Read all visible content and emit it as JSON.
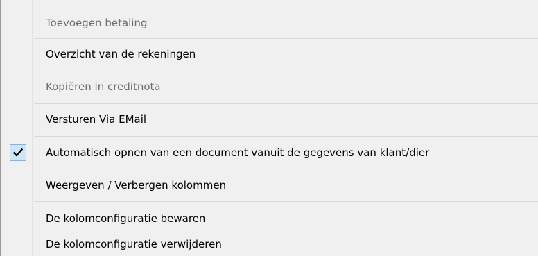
{
  "menu": {
    "items": [
      {
        "label": "Toevoegen betaling",
        "enabled": false,
        "checked": false
      },
      {
        "label": "Overzicht van de rekeningen",
        "enabled": true,
        "checked": false
      },
      {
        "label": "Kopiëren in creditnota",
        "enabled": false,
        "checked": false
      },
      {
        "label": "Versturen Via EMail",
        "enabled": true,
        "checked": false
      },
      {
        "label": "Automatisch opnen van een document vanuit de gegevens van klant/dier",
        "enabled": true,
        "checked": true
      },
      {
        "label": "Weergeven / Verbergen kolommen",
        "enabled": true,
        "checked": false
      },
      {
        "label": "De kolomconfiguratie bewaren",
        "enabled": true,
        "checked": false
      },
      {
        "label": "De kolomconfiguratie verwijderen",
        "enabled": true,
        "checked": false
      }
    ],
    "check_icon": "checkmark-icon"
  }
}
